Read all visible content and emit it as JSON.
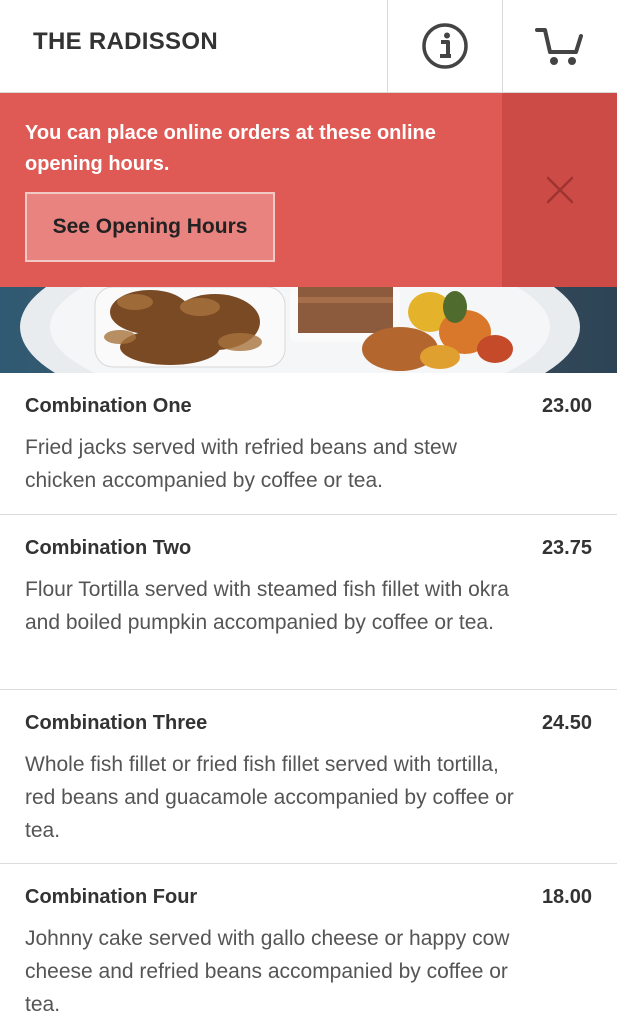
{
  "header": {
    "title": "THE RADISSON",
    "info_icon": "info-circle-icon",
    "cart_icon": "shopping-cart-icon"
  },
  "banner": {
    "message": "You can place online orders at these online opening hours.",
    "button_label": "See Opening Hours",
    "close_icon": "close-icon",
    "color": "#e05a55"
  },
  "menu": {
    "items": [
      {
        "name": "Combination One",
        "price": "23.00",
        "description": "Fried jacks served with refried beans and stew chicken accompanied by coffee or tea."
      },
      {
        "name": "Combination Two",
        "price": "23.75",
        "description": "Flour Tortilla served with steamed fish fillet with okra and boiled pumpkin accompanied by coffee or tea."
      },
      {
        "name": "Combination Three",
        "price": "24.50",
        "description": "Whole fish fillet or fried fish fillet served with tortilla, red beans and guacamole accompanied by coffee or tea."
      },
      {
        "name": "Combination Four",
        "price": "18.00",
        "description": "Johnny cake served with gallo cheese or happy cow cheese and refried beans accompanied by coffee or tea."
      }
    ]
  }
}
